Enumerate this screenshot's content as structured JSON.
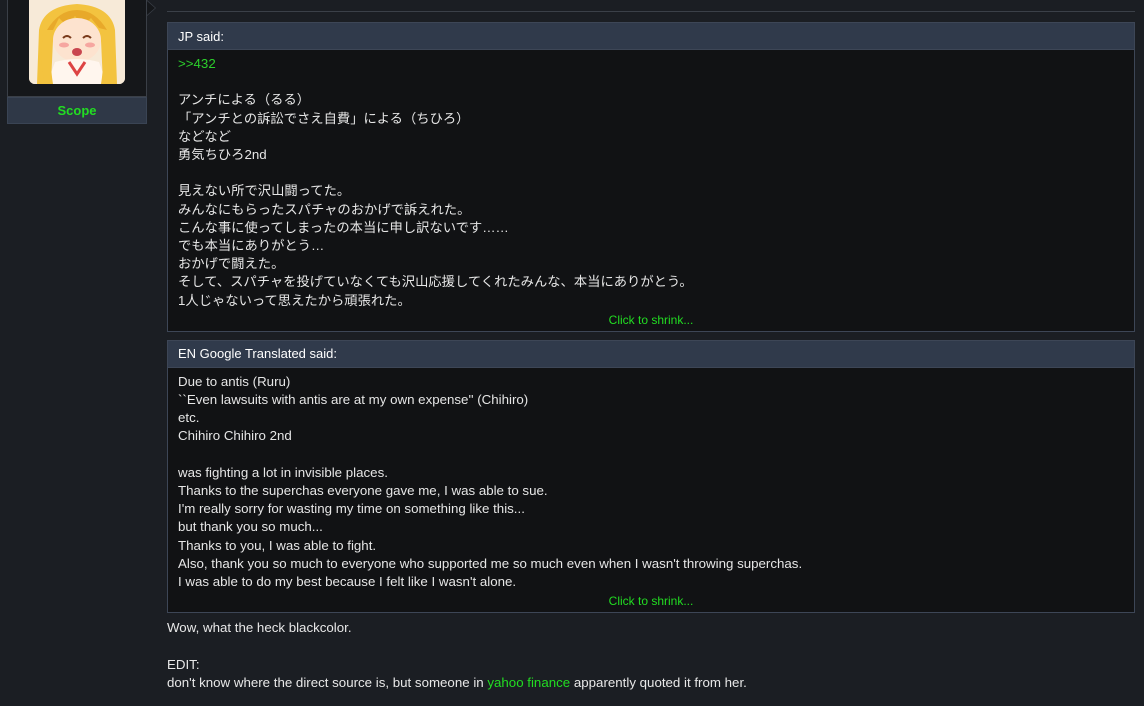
{
  "user": {
    "name": "Scope",
    "avatar_icon": "anime-girl-avatar"
  },
  "quotes": [
    {
      "author_label": "JP said:",
      "reply_link": ">>432",
      "lines": [
        "",
        "アンチによる（るる）",
        "「アンチとの訴訟でさえ自費」による（ちひろ）",
        "などなど",
        "勇気ちひろ2nd",
        "",
        "見えない所で沢山闘ってた。",
        "みんなにもらったスパチャのおかげで訴えれた。",
        "こんな事に使ってしまったの本当に申し訳ないです……",
        "でも本当にありがとう…",
        "おかげで闘えた。",
        "そして、スパチャを投げていなくても沢山応援してくれたみんな、本当にありがとう。",
        "1人じゃないって思えたから頑張れた。"
      ],
      "shrink_label": "Click to shrink..."
    },
    {
      "author_label": "EN Google Translated said:",
      "lines": [
        "Due to antis (Ruru)",
        "``Even lawsuits with antis are at my own expense'' (Chihiro)",
        "etc.",
        "Chihiro Chihiro 2nd",
        "",
        "was fighting a lot in invisible places.",
        "Thanks to the superchas everyone gave me, I was able to sue.",
        "I'm really sorry for wasting my time on something like this...",
        "but thank you so much...",
        "Thanks to you, I was able to fight.",
        "Also, thank you so much to everyone who supported me so much even when I wasn't throwing superchas.",
        "I was able to do my best because I felt like I wasn't alone."
      ],
      "shrink_label": "Click to shrink..."
    }
  ],
  "post": {
    "line1": "Wow, what the heck blackcolor.",
    "line2": "EDIT:",
    "line3_before": "don't know where the direct source is, but someone in ",
    "line3_link": "yahoo finance",
    "line3_after": " apparently quoted it from her."
  },
  "colors": {
    "accent_green": "#22dd22",
    "quote_header": "#303a4b",
    "background": "#1b1e23"
  }
}
